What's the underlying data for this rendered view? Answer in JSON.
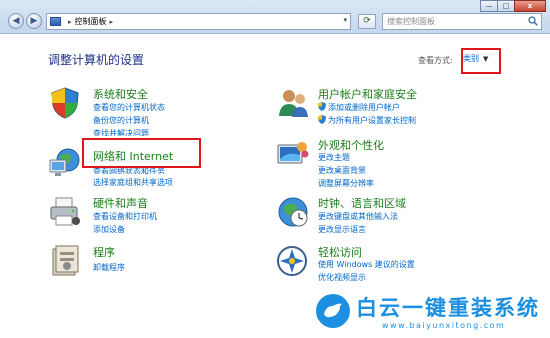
{
  "window": {
    "minimize": "—",
    "maximize": "□",
    "close": "x"
  },
  "address": {
    "separator": "▸",
    "location": "控制面板",
    "dropdown": "▾"
  },
  "search": {
    "placeholder": "搜索控制面板"
  },
  "main": {
    "heading": "调整计算机的设置",
    "view_by_label": "查看方式:",
    "view_by_value": "类别"
  },
  "categories": [
    {
      "title": "系统和安全",
      "links": [
        "查看您的计算机状态",
        "备份您的计算机",
        "查找并解决问题"
      ]
    },
    {
      "title": "网络和 Internet",
      "links": [
        "查看网络状态和任务",
        "选择家庭组和共享选项"
      ]
    },
    {
      "title": "硬件和声音",
      "links": [
        "查看设备和打印机",
        "添加设备"
      ]
    },
    {
      "title": "程序",
      "links": [
        "卸载程序"
      ]
    },
    {
      "title": "用户帐户和家庭安全",
      "links": [
        "添加或删除用户帐户",
        "为所有用户设置家长控制"
      ]
    },
    {
      "title": "外观和个性化",
      "links": [
        "更改主题",
        "更改桌面背景",
        "调整屏幕分辨率"
      ]
    },
    {
      "title": "时钟、语言和区域",
      "links": [
        "更改键盘或其他输入法",
        "更改显示语言"
      ]
    },
    {
      "title": "轻松访问",
      "links": [
        "使用 Windows 建议的设置",
        "优化视频显示"
      ]
    }
  ],
  "watermark": {
    "title": "白云一键重装系统",
    "url": "www.baiyunxitong.com"
  },
  "colors": {
    "category_title": "#1b7c1b",
    "link": "#0066cc",
    "highlight": "#e0161b",
    "watermark": "#1d8fe1"
  }
}
